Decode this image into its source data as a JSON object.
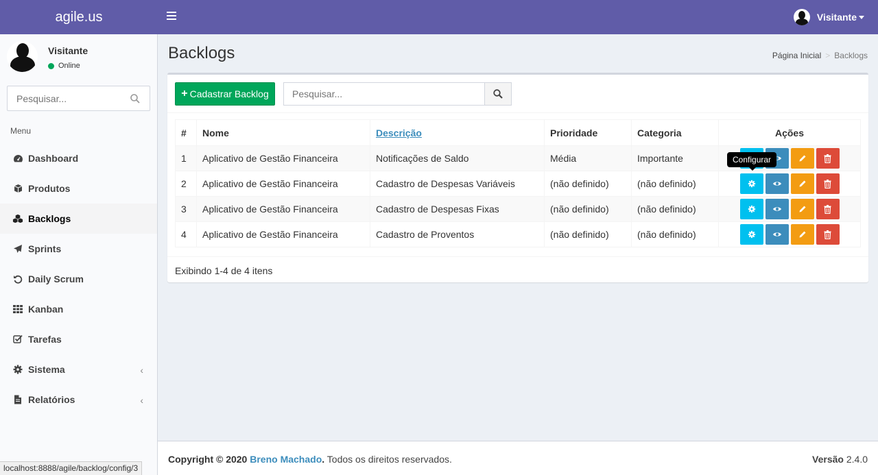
{
  "header": {
    "logo": "agile.us",
    "user_name": "Visitante"
  },
  "sidebar": {
    "user": {
      "name": "Visitante",
      "status": "Online"
    },
    "search_placeholder": "Pesquisar...",
    "menu_header": "Menu",
    "items": [
      {
        "label": "Dashboard",
        "icon": "dashboard-icon"
      },
      {
        "label": "Produtos",
        "icon": "cube-icon"
      },
      {
        "label": "Backlogs",
        "icon": "cubes-icon",
        "active": true
      },
      {
        "label": "Sprints",
        "icon": "paper-plane-icon"
      },
      {
        "label": "Daily Scrum",
        "icon": "undo-icon"
      },
      {
        "label": "Kanban",
        "icon": "grid-icon"
      },
      {
        "label": "Tarefas",
        "icon": "check-square-icon"
      },
      {
        "label": "Sistema",
        "icon": "gear-icon",
        "expandable": true
      },
      {
        "label": "Relatórios",
        "icon": "file-icon",
        "expandable": true
      }
    ]
  },
  "page": {
    "title": "Backlogs",
    "breadcrumb": [
      "Página Inicial",
      "Backlogs"
    ]
  },
  "toolbar": {
    "add_label": "Cadastrar Backlog",
    "search_placeholder": "Pesquisar..."
  },
  "table": {
    "headers": [
      "#",
      "Nome",
      "Descrição",
      "Prioridade",
      "Categoria",
      "Ações"
    ],
    "rows": [
      [
        "1",
        "Aplicativo de Gestão Financeira",
        "Notificações de Saldo",
        "Média",
        "Importante"
      ],
      [
        "2",
        "Aplicativo de Gestão Financeira",
        "Cadastro de Despesas Variáveis",
        "(não definido)",
        "(não definido)"
      ],
      [
        "3",
        "Aplicativo de Gestão Financeira",
        "Cadastro de Despesas Fixas",
        "(não definido)",
        "(não definido)"
      ],
      [
        "4",
        "Aplicativo de Gestão Financeira",
        "Cadastro de Proventos",
        "(não definido)",
        "(não definido)"
      ]
    ],
    "summary": "Exibindo 1-4 de 4 itens",
    "tooltip": "Configurar"
  },
  "footer": {
    "copyright_prefix": "Copyright © 2020",
    "author": "Breno Machado",
    "rights": ". Todos os direitos reservados.",
    "version_label": "Versão",
    "version": "2.4.0"
  },
  "statusbar": "localhost:8888/agile/backlog/config/3",
  "colors": {
    "header": "#605ca8",
    "success": "#00a65a",
    "info": "#00c0ef",
    "primary": "#3c8dbc",
    "warning": "#f39c12",
    "danger": "#dd4b39"
  }
}
